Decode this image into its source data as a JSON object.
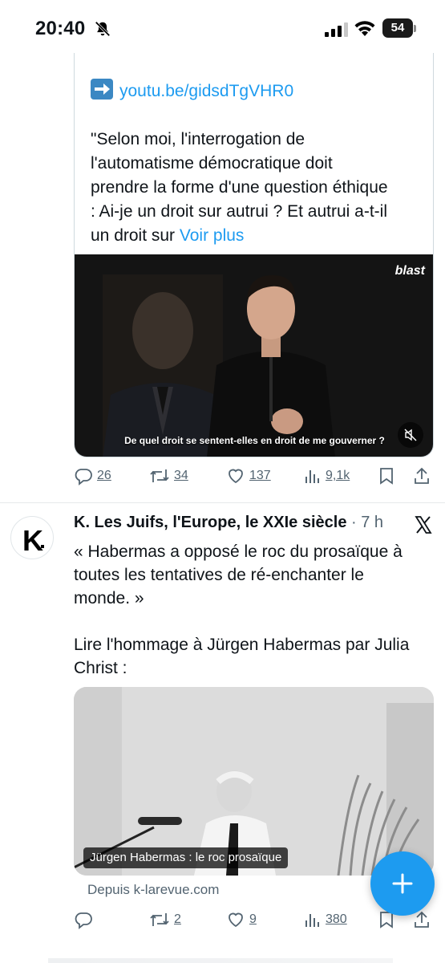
{
  "status_bar": {
    "time": "20:40",
    "battery": "54",
    "icons": [
      "bell-off-icon",
      "cellular-signal-icon",
      "wifi-icon",
      "battery-icon"
    ]
  },
  "quoted_tweet": {
    "link_text": "youtu.be/gidsdTgVHR0",
    "text_lines": [
      "\"Selon moi, l'interrogation de",
      "l'automatisme démocratique doit",
      "prendre la forme d'une question éthique",
      ": Ai-je un droit sur autrui ? Et autrui a-t-il"
    ],
    "last_line_prefix": "un droit sur ",
    "show_more": "Voir plus",
    "video": {
      "brand": "blast",
      "subtitle": "De quel droit se sentent-elles en droit de me gouverner ?"
    }
  },
  "tweet1_actions": {
    "replies": "26",
    "retweets": "34",
    "likes": "137",
    "views": "9,1k"
  },
  "tweet2": {
    "author": "K. Les Juifs, l'Europe, le XXIe siècle",
    "separator": "·",
    "time": "7 h",
    "avatar_letter": "K",
    "lines_1": [
      "« Habermas a opposé le roc du prosaïque à",
      "toutes les tentatives de ré-enchanter le",
      "monde. »"
    ],
    "lines_2": [
      "Lire l'hommage à Jürgen Habermas par Julia",
      "Christ :"
    ],
    "link_card": {
      "caption": "Jürgen Habermas : le roc prosaïque",
      "source": "Depuis k-larevue.com"
    },
    "actions": {
      "replies": "",
      "retweets": "2",
      "likes": "9",
      "views": "380"
    }
  },
  "colors": {
    "accent": "#1d9bf0",
    "text": "#0f1419",
    "secondary": "#536471",
    "border": "#cfd9de"
  }
}
